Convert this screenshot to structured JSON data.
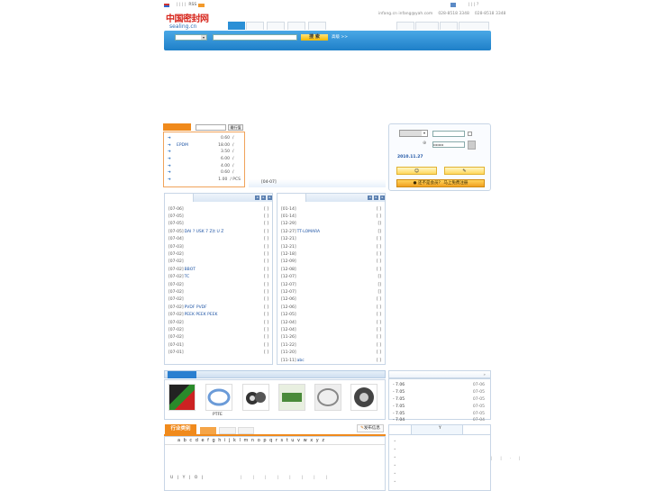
{
  "top_bar": {
    "seps_left": "| | | |",
    "rss_label": "RSS",
    "seps_right": "| | | ?"
  },
  "logo": {
    "cn_text": "中国密封网",
    "domain_text": "sealing.cn"
  },
  "contact": {
    "emails": "infang.cn  infang@yah.com",
    "phone1": "028-8518 3348",
    "phone2": "028-8518 3348"
  },
  "search": {
    "select_value": "",
    "input_value": "",
    "button_label": "搜 索",
    "advanced_label": "高级 >>"
  },
  "price_panel": {
    "input_value": "",
    "button_label": "最行值",
    "rows": [
      {
        "name": "",
        "price": "0.60",
        "unit": "/"
      },
      {
        "name": "EPDM",
        "price": "18.00",
        "unit": "/"
      },
      {
        "name": "",
        "price": "3.50",
        "unit": "/"
      },
      {
        "name": "",
        "price": "6.00",
        "unit": "/"
      },
      {
        "name": "",
        "price": "4.00",
        "unit": "/"
      },
      {
        "name": "",
        "price": "0.60",
        "unit": "/"
      },
      {
        "name": "",
        "price": "1.00",
        "unit": "/ PCS"
      }
    ]
  },
  "middle_date": "[04-07]",
  "login": {
    "user_value": "",
    "password_value": "••••••••",
    "date": "2010.11.27",
    "register_label": "还不是会员？ 马上免费注册"
  },
  "list_left": {
    "rows": [
      {
        "date": "[07-06]",
        "title": "",
        "tail": "[ ]"
      },
      {
        "date": "[07-05]",
        "title": "",
        "tail": "[ ]"
      },
      {
        "date": "[07-05]",
        "title": "",
        "tail": "[ ]"
      },
      {
        "date": "[07-05]",
        "title": "DAI ? USK 7 Z(t U Z",
        "tail": "[ ]"
      },
      {
        "date": "[07-04]",
        "title": "",
        "tail": "[ ]"
      },
      {
        "date": "[07-03]",
        "title": "",
        "tail": "[ ]"
      },
      {
        "date": "[07-02]",
        "title": "",
        "tail": "[ ]"
      },
      {
        "date": "[07-02]",
        "title": "",
        "tail": "[ ]"
      },
      {
        "date": "[07-02]",
        "title": "BBOT",
        "tail": "[ ]"
      },
      {
        "date": "[07-02]",
        "title": "TC",
        "tail": "[ ]"
      },
      {
        "date": "[07-02]",
        "title": "",
        "tail": "[ ]"
      },
      {
        "date": "[07-02]",
        "title": "",
        "tail": "[ ]"
      },
      {
        "date": "[07-02]",
        "title": "",
        "tail": "[ ]"
      },
      {
        "date": "[07-02]",
        "title": "PVDF PVDF",
        "tail": "[ ]"
      },
      {
        "date": "[07-02]",
        "title": "PEEK PEEK PEEK",
        "tail": "[ ]"
      },
      {
        "date": "[07-02]",
        "title": "",
        "tail": "[ ]"
      },
      {
        "date": "[07-02]",
        "title": "",
        "tail": "[ ]"
      },
      {
        "date": "[07-02]",
        "title": "",
        "tail": "[ ]"
      },
      {
        "date": "[07-01]",
        "title": "",
        "tail": "[ ]"
      },
      {
        "date": "[07-01]",
        "title": "",
        "tail": "[ ]"
      }
    ]
  },
  "list_right": {
    "rows": [
      {
        "date": "[01-14]",
        "title": "",
        "tail": "[ ]"
      },
      {
        "date": "[01-14]",
        "title": "",
        "tail": "[ ]"
      },
      {
        "date": "[12-29]",
        "title": "",
        "tail": "[]"
      },
      {
        "date": "[12-27]",
        "title": "TT-LOMARA",
        "tail": "[]"
      },
      {
        "date": "[12-21]",
        "title": "",
        "tail": "[ ]"
      },
      {
        "date": "[12-21]",
        "title": "",
        "tail": "[ ]"
      },
      {
        "date": "[12-18]",
        "title": "",
        "tail": "[ ]"
      },
      {
        "date": "[12-09]",
        "title": "",
        "tail": "[ ]"
      },
      {
        "date": "[12-08]",
        "title": "",
        "tail": "[ ]"
      },
      {
        "date": "[12-07]",
        "title": "",
        "tail": "[]"
      },
      {
        "date": "[12-07]",
        "title": "",
        "tail": "[]"
      },
      {
        "date": "[12-07]",
        "title": "",
        "tail": "[]"
      },
      {
        "date": "[12-06]",
        "title": "",
        "tail": "[ ]"
      },
      {
        "date": "[12-06]",
        "title": "",
        "tail": "[ ]"
      },
      {
        "date": "[12-05]",
        "title": "",
        "tail": "[ ]"
      },
      {
        "date": "[12-04]",
        "title": "",
        "tail": "[ ]"
      },
      {
        "date": "[12-04]",
        "title": "",
        "tail": "[ ]"
      },
      {
        "date": "[11-26]",
        "title": "",
        "tail": "[ ]"
      },
      {
        "date": "[11-22]",
        "title": "",
        "tail": "[ ]"
      },
      {
        "date": "[11-20]",
        "title": "",
        "tail": "[ ]"
      },
      {
        "date": "[11-11]",
        "title": "abc",
        "tail": "[ ]"
      }
    ]
  },
  "products": {
    "captions": [
      "",
      "PTFE",
      "",
      "",
      "",
      ""
    ]
  },
  "side_list": {
    "rows": [
      {
        "title": "- 7.06",
        "date": "07-06"
      },
      {
        "title": "- 7.05",
        "date": "07-05"
      },
      {
        "title": "- 7.05",
        "date": "07-05"
      },
      {
        "title": "- 7.05",
        "date": "07-05"
      },
      {
        "title": "- 7.05",
        "date": "07-05"
      },
      {
        "title": "- 7.04",
        "date": "07-04"
      }
    ]
  },
  "industry": {
    "title": "行业类别",
    "post_button": "发布信息",
    "letters": "a b c d e f g h i j k l m n o p q r s t u v w x y z",
    "bottom_row": "U | Y | O |",
    "tab_small": "Y"
  },
  "colors": {
    "banner_blue": "#2a8fd6",
    "orange": "#f08a1c",
    "link_blue": "#1f55a5"
  }
}
